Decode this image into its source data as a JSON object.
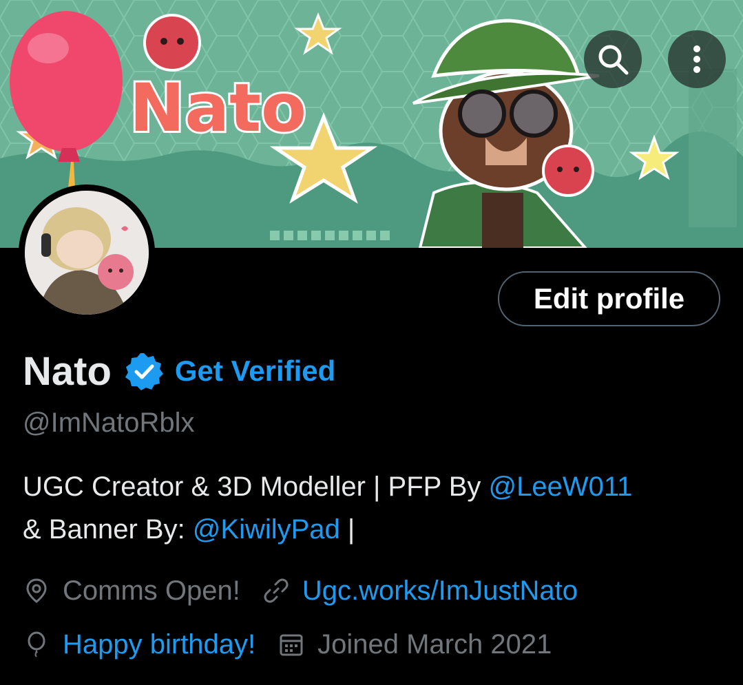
{
  "header": {
    "search_icon": "search-icon",
    "more_icon": "more-vertical-icon",
    "banner_text": "Nato"
  },
  "profile": {
    "edit_button": "Edit profile",
    "name": "Nato",
    "verified_icon": "verified-badge-icon",
    "get_verified": "Get Verified",
    "handle": "@ImNatoRblx",
    "bio": {
      "part1": "UGC Creator & 3D Modeller |  PFP By ",
      "mention1": "@LeeW011",
      "part2": "& Banner By: ",
      "mention2": "@KiwilyPad",
      "part3": " |"
    },
    "location": "Comms Open!",
    "website": "Ugc.works/ImJustNato",
    "birthday": "Happy birthday!",
    "joined": "Joined March 2021"
  },
  "colors": {
    "accent": "#1d9bf0",
    "background": "#000000",
    "muted": "#71767b",
    "banner": "#6fb59a",
    "balloon": "#f0476d"
  }
}
